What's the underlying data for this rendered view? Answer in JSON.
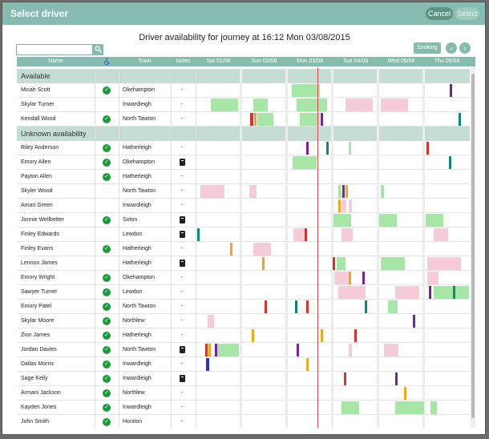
{
  "window": {
    "title": "Select driver",
    "cancel_label": "Cancel",
    "select_label": "Select"
  },
  "heading": "Driver availability for journey at 16:12 Mon 03/08/2015",
  "search": {
    "placeholder": ""
  },
  "toolbar": {
    "booking_label": "booking",
    "prev_label": "‹",
    "next_label": "›"
  },
  "columns": {
    "name": "Name",
    "town": "Town",
    "notes": "Notes",
    "days": [
      "Sat 01/08",
      "Sun 02/08",
      "Mon 03/08",
      "Tue 04/08",
      "Wed 05/08",
      "Thu 06/08"
    ]
  },
  "sections": {
    "available": "Available",
    "unknown": "Unknown availability"
  },
  "colors": {
    "available": "#a8e6a8",
    "unavailable": "#f6ccd8",
    "now": "#e24a4a"
  },
  "available_drivers": [
    {
      "name": "Micah Scott",
      "town": "Okehampton",
      "notes": "-",
      "check": true,
      "book": false
    },
    {
      "name": "Skylar Turner",
      "town": "Inwardleigh",
      "notes": "-",
      "check": false,
      "book": false
    },
    {
      "name": "Kendall Wood",
      "town": "North Tawton",
      "notes": "-",
      "check": true,
      "book": false
    }
  ],
  "unknown_drivers": [
    {
      "name": "Riley Anderson",
      "town": "Hatherleigh",
      "notes": "-",
      "check": true,
      "book": false
    },
    {
      "name": "Emory Allen",
      "town": "Okehampton",
      "notes": "",
      "check": true,
      "book": true
    },
    {
      "name": "Payton Allen",
      "town": "Hatherleigh",
      "notes": "-",
      "check": true,
      "book": false
    },
    {
      "name": "Skyler Wood",
      "town": "North Tawton",
      "notes": "-",
      "check": false,
      "book": false
    },
    {
      "name": "Amari Green",
      "town": "Inwardleigh",
      "notes": "-",
      "check": false,
      "book": false
    },
    {
      "name": "Jonnie Wellbetter",
      "town": "Soton",
      "notes": "",
      "check": true,
      "book": true
    },
    {
      "name": "Finley Edwards",
      "town": "Lewdon",
      "notes": "",
      "check": false,
      "book": true
    },
    {
      "name": "Finley Evans",
      "town": "Hatherleigh",
      "notes": "-",
      "check": true,
      "book": false
    },
    {
      "name": "Lennon James",
      "town": "Hatherleigh",
      "notes": "",
      "check": false,
      "book": true
    },
    {
      "name": "Emory Wright",
      "town": "Okehampton",
      "notes": "-",
      "check": true,
      "book": false
    },
    {
      "name": "Sawyer Turner",
      "town": "Lewdon",
      "notes": "-",
      "check": true,
      "book": false
    },
    {
      "name": "Emory Patel",
      "town": "North Tawton",
      "notes": "-",
      "check": true,
      "book": false
    },
    {
      "name": "Skylar Moore",
      "town": "Northlew",
      "notes": "-",
      "check": true,
      "book": false
    },
    {
      "name": "Zion James",
      "town": "Hatherleigh",
      "notes": "-",
      "check": true,
      "book": false
    },
    {
      "name": "Jordan Davies",
      "town": "North Tawton",
      "notes": "",
      "check": true,
      "book": true
    },
    {
      "name": "Dallas Morris",
      "town": "Inwardleigh",
      "notes": "-",
      "check": true,
      "book": false
    },
    {
      "name": "Sage Kelly",
      "town": "Inwardleigh",
      "notes": "",
      "check": true,
      "book": true
    },
    {
      "name": "Armani Jackson",
      "town": "Northlew",
      "notes": "-",
      "check": true,
      "book": false
    },
    {
      "name": "Kayden Jones",
      "town": "Inwardleigh",
      "notes": "-",
      "check": true,
      "book": false
    },
    {
      "name": "John Smith",
      "town": "Honiton",
      "notes": "-",
      "check": true,
      "book": false
    }
  ]
}
